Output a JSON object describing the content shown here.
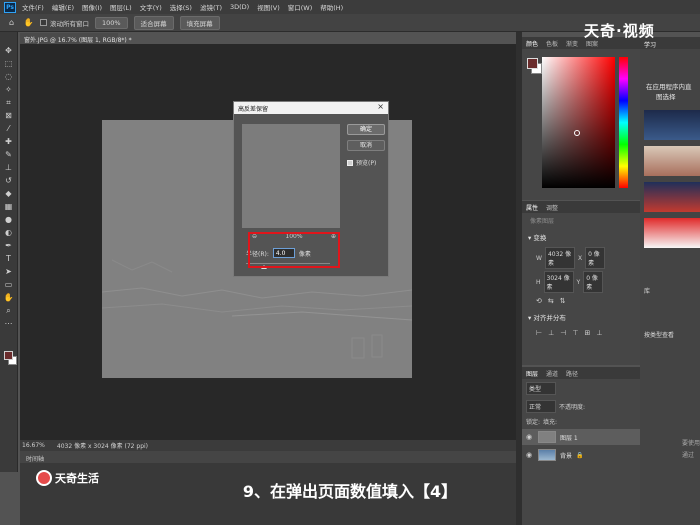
{
  "app": {
    "logo": "Ps"
  },
  "menubar": [
    "文件(F)",
    "编辑(E)",
    "图像(I)",
    "图层(L)",
    "文字(Y)",
    "选择(S)",
    "滤镜(T)",
    "3D(D)",
    "视图(V)",
    "窗口(W)",
    "帮助(H)"
  ],
  "options": {
    "scroll_all": "滚动所有窗口",
    "zoom": "100%",
    "fit_screen": "适合屏幕",
    "fill_screen": "填充屏幕"
  },
  "document": {
    "tab": "窗外.JPG @ 16.7% (图层 1, RGB/8*) *",
    "zoom_status": "16.67%",
    "size_status": "4032 像素 x 3024 像素 (72 ppi)"
  },
  "timeline": {
    "label": "时间轴"
  },
  "dialog": {
    "title": "高反差保留",
    "ok": "确定",
    "cancel": "取消",
    "preview_label": "预览(P)",
    "zoom_level": "100%",
    "radius_label": "半径(R):",
    "radius_value": "4.0",
    "unit": "像素"
  },
  "color_panel": {
    "tabs": [
      "颜色",
      "色板",
      "渐变",
      "图案"
    ],
    "fg_color": "#6a2c2c",
    "bg_color": "#ffffff"
  },
  "properties": {
    "tabs": [
      "属性",
      "调整"
    ],
    "subtitle": "像素图层",
    "transform_label": "变换",
    "w": "4032 像素",
    "h": "3024 像素",
    "x": "0 像素",
    "y": "0 像素",
    "align_label": "对齐并分布"
  },
  "layers_panel": {
    "tabs": [
      "图层",
      "通道",
      "路径"
    ],
    "kind_filter": "类型",
    "blend_mode": "正常",
    "opacity_label": "不透明度:",
    "lock_label": "锁定:",
    "fill_label": "填充:",
    "layers": [
      {
        "name": "图层 1"
      },
      {
        "name": "背景"
      }
    ]
  },
  "right_panel": {
    "tabs": [
      "学习",
      "库"
    ],
    "learn_text_1": "在应用程序内直",
    "learn_text_2": "图选择",
    "library_label": "按类型查看",
    "footer_text_1": "要使用",
    "footer_text_2": "通过"
  },
  "watermark": "天奇·视频",
  "logo_text": "天奇生活",
  "caption": "9、在弹出页面数值填入【4】"
}
